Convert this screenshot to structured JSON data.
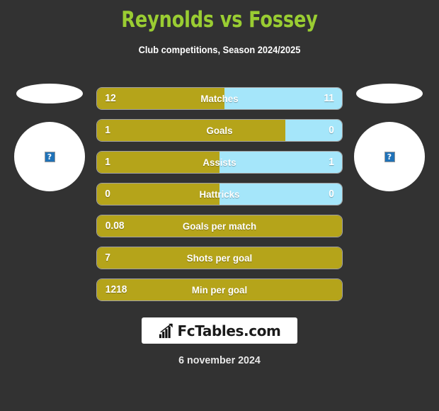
{
  "header": {
    "title": "Reynolds vs Fossey",
    "subtitle": "Club competitions, Season 2024/2025",
    "title_color": "#9ACD32"
  },
  "theme": {
    "background": "#323232",
    "home_color": "#B5A41A",
    "away_color": "#A5E6FA",
    "text_color": "#FFFFFF"
  },
  "players": {
    "home": {
      "photo_placeholder_icon": "broken-image-icon",
      "flag_placeholder_icon": "flag-placeholder-icon"
    },
    "away": {
      "photo_placeholder_icon": "broken-image-icon",
      "flag_placeholder_icon": "flag-placeholder-icon"
    }
  },
  "chart_data": {
    "type": "bar",
    "title": "Reynolds vs Fossey",
    "subtitle": "Club competitions, Season 2024/2025",
    "orientation": "horizontal-paired",
    "series": [
      {
        "name": "Reynolds",
        "color": "#B5A41A"
      },
      {
        "name": "Fossey",
        "color": "#A5E6FA"
      }
    ],
    "categories": [
      "Matches",
      "Goals",
      "Assists",
      "Hattricks",
      "Goals per match",
      "Shots per goal",
      "Min per goal"
    ],
    "rows": [
      {
        "label": "Matches",
        "home": "12",
        "away": "11",
        "home_pct": 52,
        "split": true
      },
      {
        "label": "Goals",
        "home": "1",
        "away": "0",
        "home_pct": 77,
        "split": true
      },
      {
        "label": "Assists",
        "home": "1",
        "away": "1",
        "home_pct": 50,
        "split": true
      },
      {
        "label": "Hattricks",
        "home": "0",
        "away": "0",
        "home_pct": 50,
        "split": true
      },
      {
        "label": "Goals per match",
        "home": "0.08",
        "away": "",
        "home_pct": 100,
        "split": false
      },
      {
        "label": "Shots per goal",
        "home": "7",
        "away": "",
        "home_pct": 100,
        "split": false
      },
      {
        "label": "Min per goal",
        "home": "1218",
        "away": "",
        "home_pct": 100,
        "split": false
      }
    ]
  },
  "footer": {
    "logo_text": "FcTables.com",
    "logo_icon": "bar-chart-arrow-icon",
    "date": "6 november 2024"
  }
}
